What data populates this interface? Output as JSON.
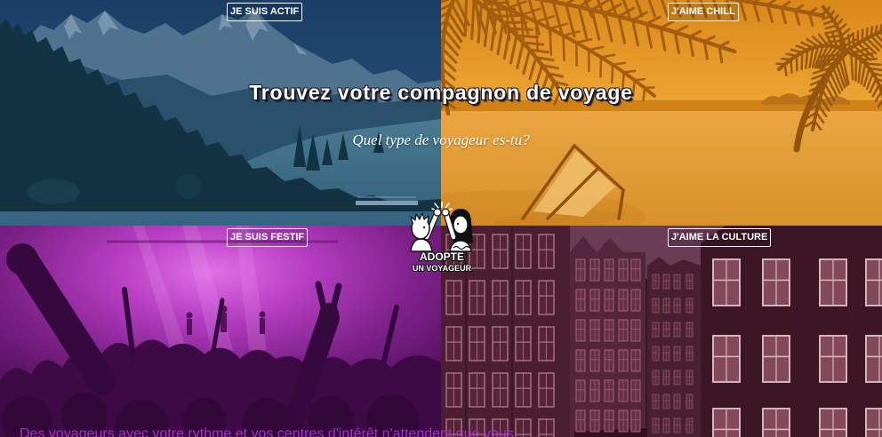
{
  "hero": {
    "title": "Trouvez votre compagnon de voyage",
    "subtitle": "Quel type de voyageur es-tu?"
  },
  "logo": {
    "icon": "high-five-logo-icon",
    "line1": "ADOPTE",
    "line2": "UN VOYAGEUR"
  },
  "tiles": [
    {
      "label": "JE SUIS ACTIF",
      "tint": "#1c4c86"
    },
    {
      "label": "J'AIME CHILL",
      "tint": "#e08c12"
    },
    {
      "label": "JE SUIS FESTIF",
      "tint": "#a22cb4"
    },
    {
      "label": "J'AIME LA CULTURE",
      "tint": "#5c2034"
    }
  ],
  "footer": {
    "text": "Des voyageurs avec votre rythme et vos centres d'intérêt n'attendent que vous"
  },
  "colors": {
    "footer_text": "#a530c8",
    "button_border": "#ffffff",
    "title_text": "#ffffff"
  }
}
